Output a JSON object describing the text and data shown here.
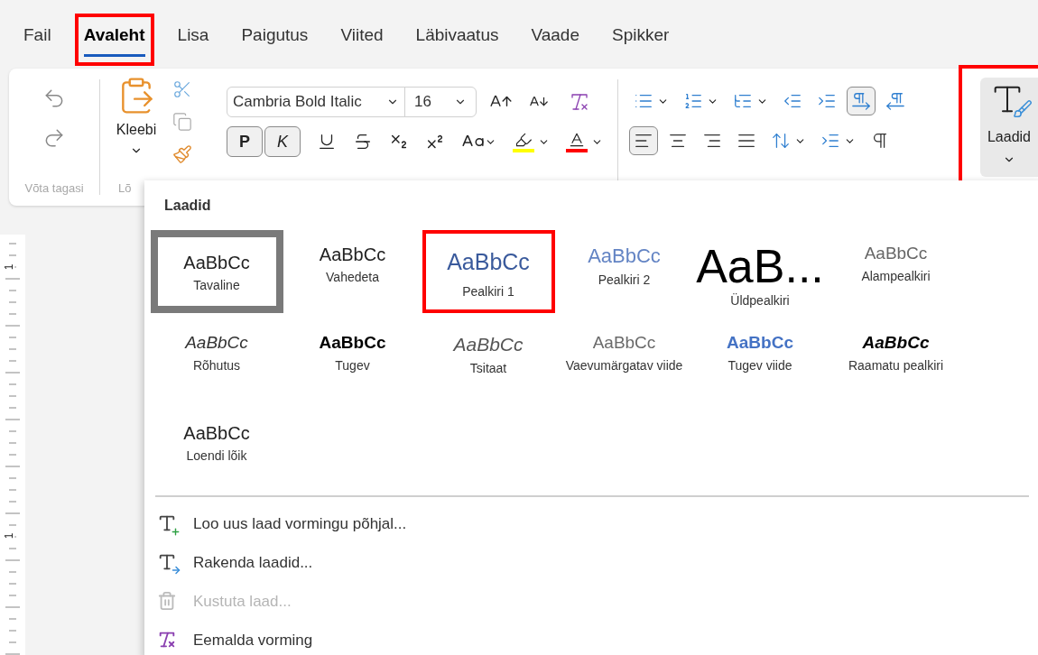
{
  "tabs": [
    {
      "label": "Fail",
      "selected": false,
      "annotated": false
    },
    {
      "label": "Avaleht",
      "selected": true,
      "annotated": true
    },
    {
      "label": "Lisa",
      "selected": false,
      "annotated": false
    },
    {
      "label": "Paigutus",
      "selected": false,
      "annotated": false
    },
    {
      "label": "Viited",
      "selected": false,
      "annotated": false
    },
    {
      "label": "Läbivaatus",
      "selected": false,
      "annotated": false
    },
    {
      "label": "Vaade",
      "selected": false,
      "annotated": false
    },
    {
      "label": "Spikker",
      "selected": false,
      "annotated": false
    }
  ],
  "ribbon": {
    "undo_group": {
      "label": "Võta tagasi"
    },
    "clipboard": {
      "paste_label": "Kleebi",
      "group_label": "Lõ"
    },
    "font": {
      "font_name": "Cambria Bold Italic",
      "font_size": "16",
      "bold": {
        "label": "P",
        "pressed": true
      },
      "italic": {
        "label": "K",
        "pressed": true
      }
    },
    "paragraph": {
      "row_1": [
        {
          "kind": "bullets",
          "pressed": false
        },
        {
          "kind": "numbering",
          "pressed": false
        },
        {
          "kind": "multilevel",
          "pressed": false
        },
        {
          "kind": "outdent",
          "pressed": false
        },
        {
          "kind": "indent",
          "pressed": false
        },
        {
          "kind": "ltr",
          "pressed": true
        },
        {
          "kind": "rtl",
          "pressed": false
        }
      ],
      "row_2": [
        {
          "kind": "align-left",
          "pressed": true
        },
        {
          "kind": "align-center",
          "pressed": false
        },
        {
          "kind": "align-right",
          "pressed": false
        },
        {
          "kind": "justify",
          "pressed": false
        },
        {
          "kind": "line-spacing",
          "pressed": false
        },
        {
          "kind": "indent-menu",
          "pressed": false
        },
        {
          "kind": "pilcrow",
          "pressed": false
        }
      ]
    },
    "styles_button": {
      "label": "Laadid",
      "annotated": true
    }
  },
  "ruler": {
    "labels": [
      "1",
      "1"
    ]
  },
  "styles_panel": {
    "title": "Laadid",
    "styles": [
      {
        "preview": "AaBbCc",
        "label": "Tavaline",
        "kind": "normal",
        "selected": true,
        "annotated": false
      },
      {
        "preview": "AaBbCc",
        "label": "Vahedeta",
        "kind": "normal",
        "selected": false,
        "annotated": false
      },
      {
        "preview": "AaBbCc",
        "label": "Pealkiri 1",
        "kind": "heading1",
        "selected": false,
        "annotated": true
      },
      {
        "preview": "AaBbCc",
        "label": "Pealkiri 2",
        "kind": "heading2",
        "selected": false,
        "annotated": false
      },
      {
        "preview": "AaB...",
        "label": "Üldpealkiri",
        "kind": "title",
        "selected": false,
        "annotated": false
      },
      {
        "preview": "AaBbCc",
        "label": "Alampealkiri",
        "kind": "subtitle",
        "selected": false,
        "annotated": false
      },
      {
        "preview": "AaBbCc",
        "label": "Rõhutus",
        "kind": "emphasis",
        "selected": false,
        "annotated": false
      },
      {
        "preview": "AaBbCc",
        "label": "Tugev",
        "kind": "strong",
        "selected": false,
        "annotated": false
      },
      {
        "preview": "AaBbCc",
        "label": "Tsitaat",
        "kind": "quote",
        "selected": false,
        "annotated": false
      },
      {
        "preview": "AaBbCc",
        "label": "Vaevumärgatav viide",
        "kind": "subtle",
        "selected": false,
        "annotated": false
      },
      {
        "preview": "AaBbCc",
        "label": "Tugev viide",
        "kind": "intense",
        "selected": false,
        "annotated": false
      },
      {
        "preview": "AaBbCc",
        "label": "Raamatu pealkiri",
        "kind": "book",
        "selected": false,
        "annotated": false
      },
      {
        "preview": "AaBbCc",
        "label": "Loendi lõik",
        "kind": "normal",
        "selected": false,
        "annotated": false
      }
    ],
    "menu": [
      {
        "label": "Loo uus laad vormingu põhjal...",
        "kind": "new",
        "disabled": false
      },
      {
        "label": "Rakenda laadid...",
        "kind": "apply",
        "disabled": false
      },
      {
        "label": "Kustuta laad...",
        "kind": "delete",
        "disabled": true
      },
      {
        "label": "Eemalda vorming",
        "kind": "clear",
        "disabled": false
      }
    ]
  }
}
